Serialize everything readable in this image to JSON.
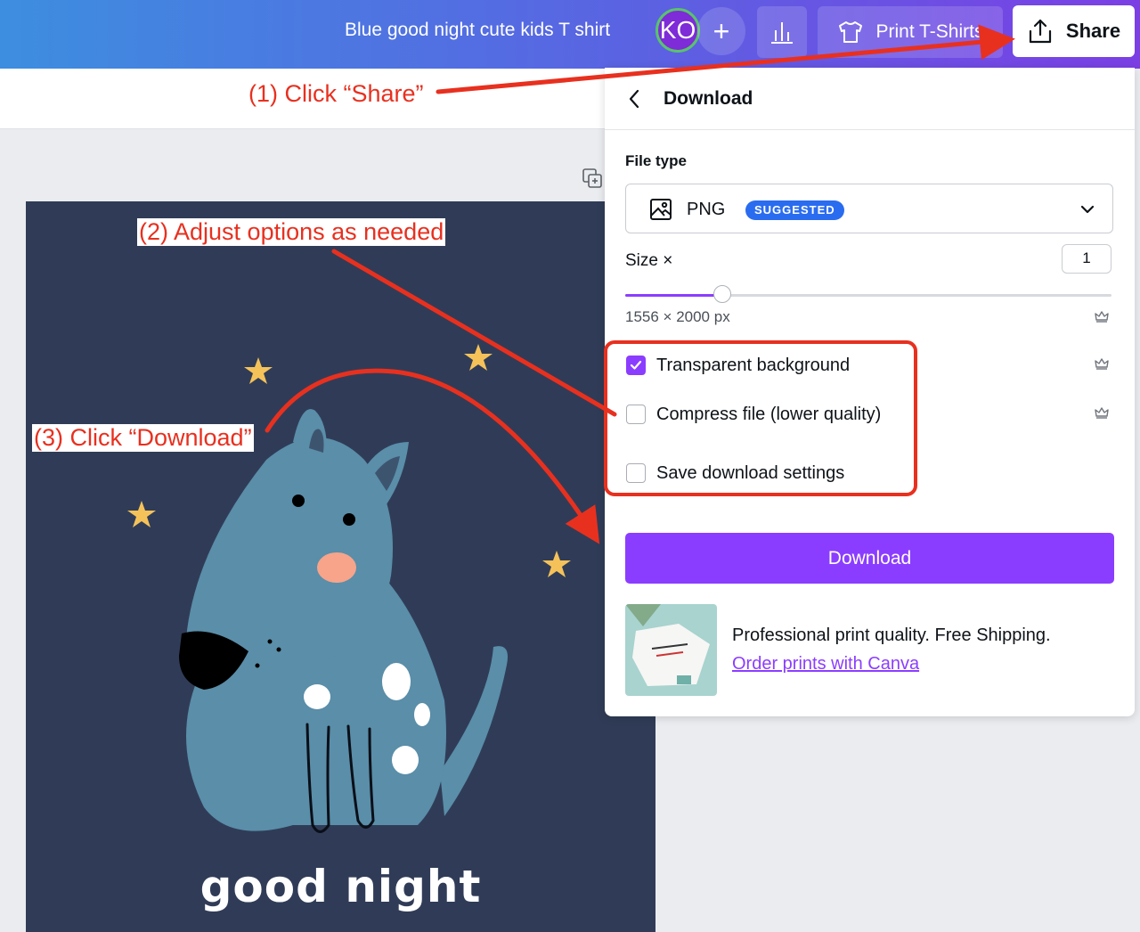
{
  "header": {
    "doc_title": "Blue good night cute kids T shirt",
    "avatar_initials": "KO",
    "add_symbol": "+",
    "print_label": "Print T-Shirts",
    "share_label": "Share"
  },
  "design": {
    "caption": "good night"
  },
  "download_panel": {
    "title": "Download",
    "file_type_label": "File type",
    "file_type_value": "PNG",
    "file_type_badge": "SUGGESTED",
    "size_label": "Size ×",
    "size_value": "1",
    "size_fraction": 0.2,
    "dimensions": "1556 × 2000 px",
    "options": [
      {
        "label": "Transparent background",
        "checked": true
      },
      {
        "label": "Compress file (lower quality)",
        "checked": false
      },
      {
        "label": "Save download settings",
        "checked": false
      }
    ],
    "download_label": "Download",
    "promo_text": "Professional print quality. Free Shipping.",
    "promo_link": "Order prints with Canva"
  },
  "annotations": {
    "step1": "(1) Click “Share”",
    "step2": "(2) Adjust options as needed",
    "step3": "(3) Click “Download”",
    "color": "#e8301f"
  },
  "colors": {
    "accent": "#8b3dff",
    "badge": "#2a6cf0",
    "canvas_bg": "#303c57",
    "dog": "#5a8ea9"
  }
}
